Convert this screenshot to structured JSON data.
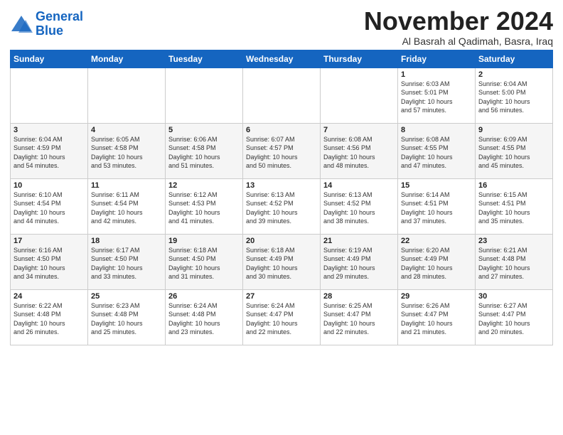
{
  "logo": {
    "line1": "General",
    "line2": "Blue"
  },
  "title": "November 2024",
  "subtitle": "Al Basrah al Qadimah, Basra, Iraq",
  "weekdays": [
    "Sunday",
    "Monday",
    "Tuesday",
    "Wednesday",
    "Thursday",
    "Friday",
    "Saturday"
  ],
  "weeks": [
    [
      {
        "day": "",
        "info": ""
      },
      {
        "day": "",
        "info": ""
      },
      {
        "day": "",
        "info": ""
      },
      {
        "day": "",
        "info": ""
      },
      {
        "day": "",
        "info": ""
      },
      {
        "day": "1",
        "info": "Sunrise: 6:03 AM\nSunset: 5:01 PM\nDaylight: 10 hours\nand 57 minutes."
      },
      {
        "day": "2",
        "info": "Sunrise: 6:04 AM\nSunset: 5:00 PM\nDaylight: 10 hours\nand 56 minutes."
      }
    ],
    [
      {
        "day": "3",
        "info": "Sunrise: 6:04 AM\nSunset: 4:59 PM\nDaylight: 10 hours\nand 54 minutes."
      },
      {
        "day": "4",
        "info": "Sunrise: 6:05 AM\nSunset: 4:58 PM\nDaylight: 10 hours\nand 53 minutes."
      },
      {
        "day": "5",
        "info": "Sunrise: 6:06 AM\nSunset: 4:58 PM\nDaylight: 10 hours\nand 51 minutes."
      },
      {
        "day": "6",
        "info": "Sunrise: 6:07 AM\nSunset: 4:57 PM\nDaylight: 10 hours\nand 50 minutes."
      },
      {
        "day": "7",
        "info": "Sunrise: 6:08 AM\nSunset: 4:56 PM\nDaylight: 10 hours\nand 48 minutes."
      },
      {
        "day": "8",
        "info": "Sunrise: 6:08 AM\nSunset: 4:55 PM\nDaylight: 10 hours\nand 47 minutes."
      },
      {
        "day": "9",
        "info": "Sunrise: 6:09 AM\nSunset: 4:55 PM\nDaylight: 10 hours\nand 45 minutes."
      }
    ],
    [
      {
        "day": "10",
        "info": "Sunrise: 6:10 AM\nSunset: 4:54 PM\nDaylight: 10 hours\nand 44 minutes."
      },
      {
        "day": "11",
        "info": "Sunrise: 6:11 AM\nSunset: 4:54 PM\nDaylight: 10 hours\nand 42 minutes."
      },
      {
        "day": "12",
        "info": "Sunrise: 6:12 AM\nSunset: 4:53 PM\nDaylight: 10 hours\nand 41 minutes."
      },
      {
        "day": "13",
        "info": "Sunrise: 6:13 AM\nSunset: 4:52 PM\nDaylight: 10 hours\nand 39 minutes."
      },
      {
        "day": "14",
        "info": "Sunrise: 6:13 AM\nSunset: 4:52 PM\nDaylight: 10 hours\nand 38 minutes."
      },
      {
        "day": "15",
        "info": "Sunrise: 6:14 AM\nSunset: 4:51 PM\nDaylight: 10 hours\nand 37 minutes."
      },
      {
        "day": "16",
        "info": "Sunrise: 6:15 AM\nSunset: 4:51 PM\nDaylight: 10 hours\nand 35 minutes."
      }
    ],
    [
      {
        "day": "17",
        "info": "Sunrise: 6:16 AM\nSunset: 4:50 PM\nDaylight: 10 hours\nand 34 minutes."
      },
      {
        "day": "18",
        "info": "Sunrise: 6:17 AM\nSunset: 4:50 PM\nDaylight: 10 hours\nand 33 minutes."
      },
      {
        "day": "19",
        "info": "Sunrise: 6:18 AM\nSunset: 4:50 PM\nDaylight: 10 hours\nand 31 minutes."
      },
      {
        "day": "20",
        "info": "Sunrise: 6:18 AM\nSunset: 4:49 PM\nDaylight: 10 hours\nand 30 minutes."
      },
      {
        "day": "21",
        "info": "Sunrise: 6:19 AM\nSunset: 4:49 PM\nDaylight: 10 hours\nand 29 minutes."
      },
      {
        "day": "22",
        "info": "Sunrise: 6:20 AM\nSunset: 4:49 PM\nDaylight: 10 hours\nand 28 minutes."
      },
      {
        "day": "23",
        "info": "Sunrise: 6:21 AM\nSunset: 4:48 PM\nDaylight: 10 hours\nand 27 minutes."
      }
    ],
    [
      {
        "day": "24",
        "info": "Sunrise: 6:22 AM\nSunset: 4:48 PM\nDaylight: 10 hours\nand 26 minutes."
      },
      {
        "day": "25",
        "info": "Sunrise: 6:23 AM\nSunset: 4:48 PM\nDaylight: 10 hours\nand 25 minutes."
      },
      {
        "day": "26",
        "info": "Sunrise: 6:24 AM\nSunset: 4:48 PM\nDaylight: 10 hours\nand 23 minutes."
      },
      {
        "day": "27",
        "info": "Sunrise: 6:24 AM\nSunset: 4:47 PM\nDaylight: 10 hours\nand 22 minutes."
      },
      {
        "day": "28",
        "info": "Sunrise: 6:25 AM\nSunset: 4:47 PM\nDaylight: 10 hours\nand 22 minutes."
      },
      {
        "day": "29",
        "info": "Sunrise: 6:26 AM\nSunset: 4:47 PM\nDaylight: 10 hours\nand 21 minutes."
      },
      {
        "day": "30",
        "info": "Sunrise: 6:27 AM\nSunset: 4:47 PM\nDaylight: 10 hours\nand 20 minutes."
      }
    ]
  ]
}
